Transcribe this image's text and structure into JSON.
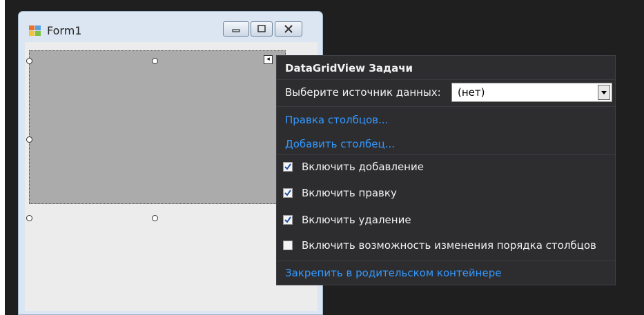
{
  "form": {
    "title": "Form1",
    "window_buttons": [
      "minimize",
      "maximize",
      "close"
    ]
  },
  "icons": {
    "form_icon": "windows-form-icon",
    "minimize": "minimize-icon",
    "maximize": "maximize-icon",
    "close": "close-icon",
    "smart_tag": "smart-tag-arrow-icon",
    "dropdown": "chevron-down-icon",
    "check": "check-icon"
  },
  "smart_tag_glyph": "◂",
  "tasks_panel": {
    "title": "DataGridView Задачи",
    "data_source_label": "Выберите источник данных:",
    "data_source_value": "(нет)",
    "links": {
      "edit_columns": "Правка столбцов...",
      "add_column": "Добавить столбец..."
    },
    "options": [
      {
        "label": "Включить добавление",
        "checked": true
      },
      {
        "label": "Включить правку",
        "checked": true
      },
      {
        "label": "Включить удаление",
        "checked": true
      },
      {
        "label": "Включить возможность изменения порядка столбцов",
        "checked": false
      }
    ],
    "dock_link": "Закрепить в родительском контейнере"
  },
  "colors": {
    "panel_bg": "#2d2d30",
    "link": "#3399ff",
    "grid_fill": "#ababab",
    "form_frame": "#dbe6f2"
  }
}
